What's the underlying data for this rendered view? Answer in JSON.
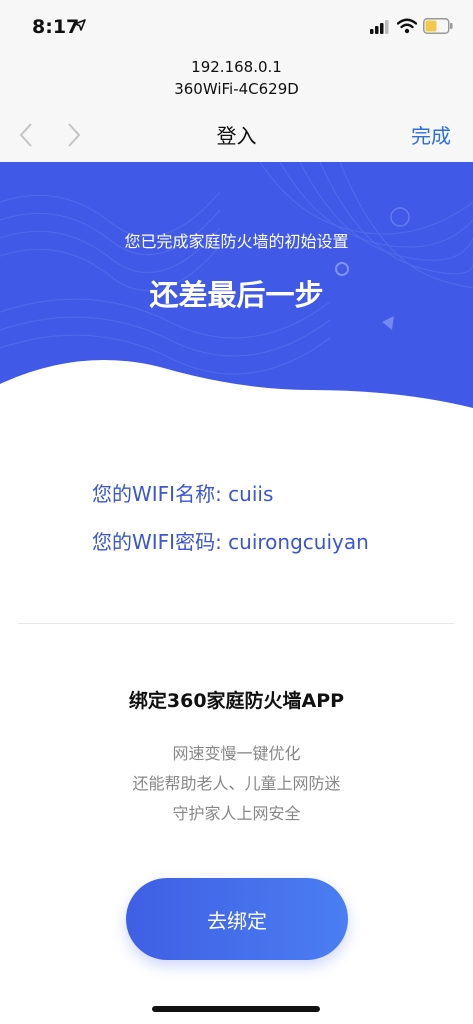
{
  "status_bar": {
    "time": "8:17",
    "icons": [
      "location-arrow-icon",
      "cellular-signal-icon",
      "wifi-icon",
      "battery-icon"
    ],
    "battery_color": "#f2c94c"
  },
  "browser": {
    "host": "192.168.0.1",
    "ssid": "360WiFi-4C629D",
    "page_title": "登入",
    "done_label": "完成",
    "back_icon": "chevron-left-icon",
    "forward_icon": "chevron-right-icon"
  },
  "hero": {
    "subtitle": "您已完成家庭防火墙的初始设置",
    "title": "还差最后一步",
    "color": "#4059e6"
  },
  "wifi": {
    "name_line": "您的WIFI名称: cuiis",
    "password_line": "您的WIFI密码: cuirongcuiyan"
  },
  "app": {
    "title": "绑定360家庭防火墙APP",
    "desc": [
      "网速变慢一键优化",
      "还能帮助老人、儿童上网防迷",
      "守护家人上网安全"
    ],
    "button_label": "去绑定"
  },
  "colors": {
    "accent": "#3b55d6",
    "link": "#2f6fd6"
  }
}
